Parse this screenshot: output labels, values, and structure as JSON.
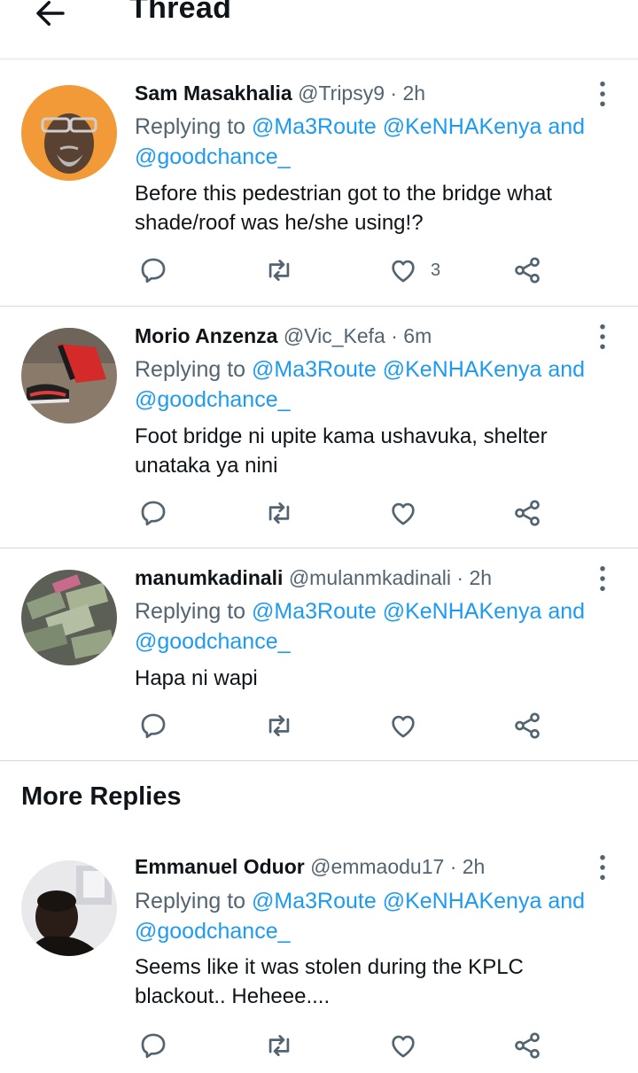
{
  "header": {
    "title": "Thread",
    "back_icon": "arrow-left-icon"
  },
  "tweets": [
    {
      "name": "Sam Masakhalia",
      "handle": "@Tripsy9",
      "time": "2h",
      "replying_prefix": "Replying to",
      "mention1": "@Ma3Route",
      "mention2": "@KeNHAKenya",
      "mention_and": "and",
      "mention3": "@goodchance_",
      "text": "Before this pedestrian got to the bridge what shade/roof was he/she using!?",
      "likes": "3"
    },
    {
      "name": "Morio Anzenza",
      "handle": "@Vic_Kefa",
      "time": "6m",
      "replying_prefix": "Replying to",
      "mention1": "@Ma3Route",
      "mention2": "@KeNHAKenya",
      "mention_and": "and",
      "mention3": "@goodchance_",
      "text": "Foot bridge ni upite kama ushavuka, shelter unataka ya nini",
      "likes": ""
    },
    {
      "name": "manumkadinali",
      "handle": "@mulanmkadinali",
      "time": "2h",
      "replying_prefix": "Replying to",
      "mention1": "@Ma3Route",
      "mention2": "@KeNHAKenya",
      "mention_and": "and",
      "mention3": "@goodchance_",
      "text": "Hapa ni wapi",
      "likes": ""
    }
  ],
  "more_replies": {
    "title": "More Replies",
    "tweets": [
      {
        "name": "Emmanuel Oduor",
        "handle": "@emmaodu17",
        "time": "2h",
        "replying_prefix": "Replying to",
        "mention1": "@Ma3Route",
        "mention2": "@KeNHAKenya",
        "mention_and": "and",
        "mention3": "@goodchance_",
        "text": "Seems like it was stolen during the KPLC blackout.. Heheee....",
        "likes": ""
      }
    ]
  },
  "separator": "·",
  "colors": {
    "accent": "#1d9bf0",
    "secondary_text": "#536471",
    "border": "#cfd9de"
  },
  "icons": [
    "arrow-left-icon",
    "more-vertical-icon",
    "reply-icon",
    "retweet-icon",
    "like-icon",
    "share-icon"
  ]
}
